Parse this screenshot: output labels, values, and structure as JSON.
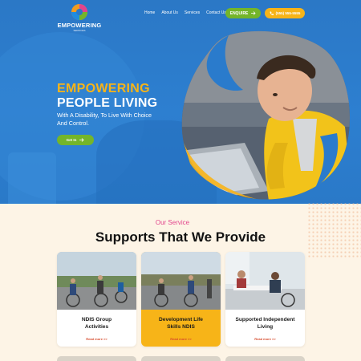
{
  "header": {
    "logo_word": "EMPOWERING",
    "logo_sub": "SERVICES",
    "nav": [
      "Home",
      "About Us",
      "Services",
      "Contact Us"
    ],
    "enquire_label": "ENQUIRE",
    "phone_label": "(555) 555-5555"
  },
  "hero": {
    "headline_1": "EMPOWERING",
    "headline_2": "PEOPLE LIVING",
    "description": "With A Disability, To Live With Choice And Control.",
    "cta_label": "Get In"
  },
  "services": {
    "eyebrow": "Our Service",
    "title": "Supports That We Provide",
    "cards": [
      {
        "title_1": "NDIS Group",
        "title_2": "Activities",
        "more": "Read more >>"
      },
      {
        "title_1": "Development Life",
        "title_2": "Skills NDIS",
        "more": "Read more >>"
      },
      {
        "title_1": "Supported Independent",
        "title_2": "Living",
        "more": "Read more >>"
      }
    ]
  },
  "colors": {
    "hero_blue": "#2b78c6",
    "accent_yellow": "#f7b418",
    "accent_green": "#74b52a",
    "eyebrow_pink": "#e2448c",
    "page_cream": "#fdf4e6"
  }
}
